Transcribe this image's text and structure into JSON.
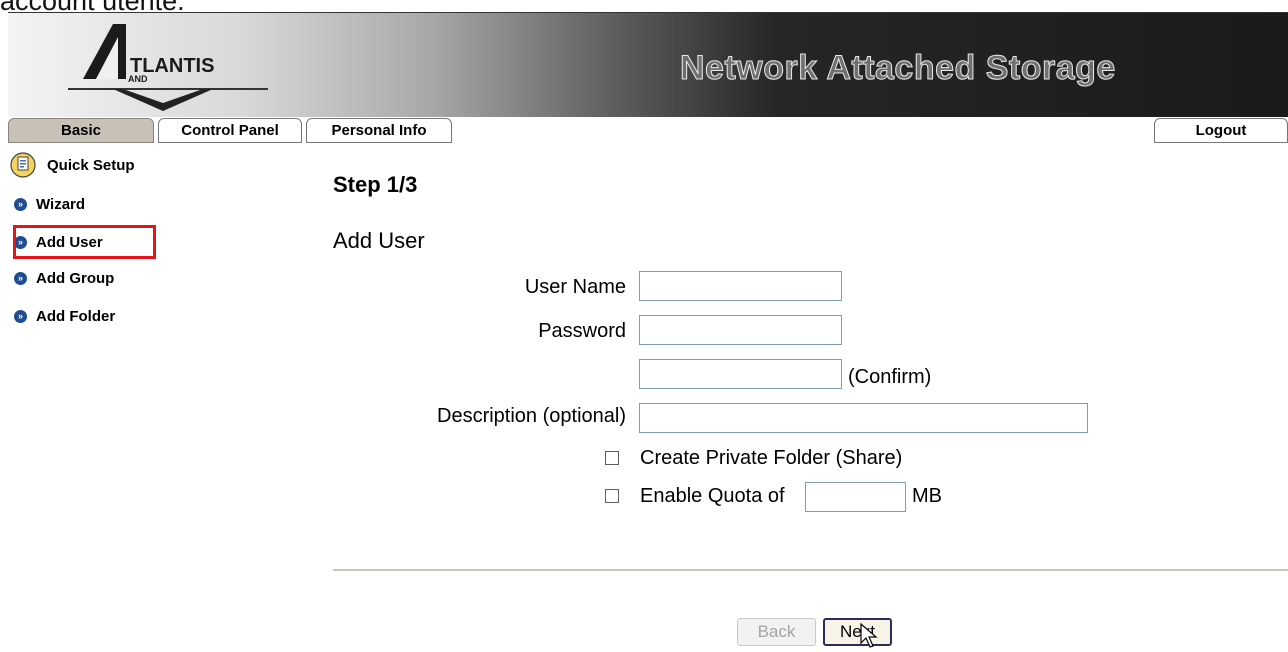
{
  "caption": "account utente.",
  "header": {
    "logo_text": "ATLANTIS AND",
    "title": "Network Attached Storage"
  },
  "tabs": [
    {
      "label": "Basic",
      "active": true
    },
    {
      "label": "Control Panel",
      "active": false
    },
    {
      "label": "Personal Info",
      "active": false
    }
  ],
  "logout_label": "Logout",
  "sidebar": {
    "section_label": "Quick Setup",
    "section_icon": "quick-setup-icon",
    "items": [
      {
        "label": "Wizard",
        "selected": false
      },
      {
        "label": "Add User",
        "selected": true
      },
      {
        "label": "Add Group",
        "selected": false
      },
      {
        "label": "Add Folder",
        "selected": false
      }
    ]
  },
  "form": {
    "step": "Step 1/3",
    "title": "Add User",
    "user_name_label": "User Name",
    "user_name_value": "",
    "password_label": "Password",
    "password_value": "",
    "confirm_value": "",
    "confirm_label": "(Confirm)",
    "description_label": "Description (optional)",
    "description_value": "",
    "private_folder_label": "Create Private Folder (Share)",
    "private_folder_checked": false,
    "quota_label": "Enable Quota of",
    "quota_checked": false,
    "quota_value": "",
    "quota_unit": "MB"
  },
  "buttons": {
    "back": "Back",
    "next": "Next"
  },
  "colors": {
    "highlight": "#e5141b",
    "tab_active": "#c8c1b8",
    "bullet": "#1f4d92"
  }
}
